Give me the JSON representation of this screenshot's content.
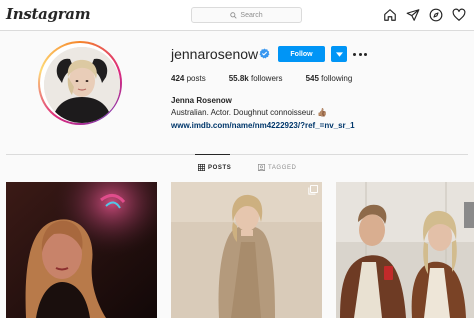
{
  "nav": {
    "logo": "Instagram",
    "search_placeholder": "Search",
    "icons": [
      "home-icon",
      "direct-messages-icon",
      "explore-icon",
      "activity-heart-icon"
    ]
  },
  "profile": {
    "username": "jennarosenow",
    "verified": true,
    "follow_label": "Follow",
    "posts_count": "424",
    "posts_label": "posts",
    "followers_count": "55.8k",
    "followers_label": "followers",
    "following_count": "545",
    "following_label": "following",
    "full_name": "Jenna Rosenow",
    "bio": "Australian. Actor. Doughnut connoisseur. 👍🏽",
    "website": "www.imdb.com/name/nm4222923/?ref_=nv_sr_1"
  },
  "tabs": [
    {
      "label": "POSTS",
      "active": true
    },
    {
      "label": "TAGGED",
      "active": false
    }
  ],
  "colors": {
    "follow_blue": "#0095f6",
    "link": "#00376b",
    "border": "#dbdbdb"
  },
  "posts": [
    {
      "description": "selfie",
      "multi": false
    },
    {
      "description": "portrait-coat",
      "multi": true
    },
    {
      "description": "couple-mirror",
      "multi": false
    }
  ]
}
